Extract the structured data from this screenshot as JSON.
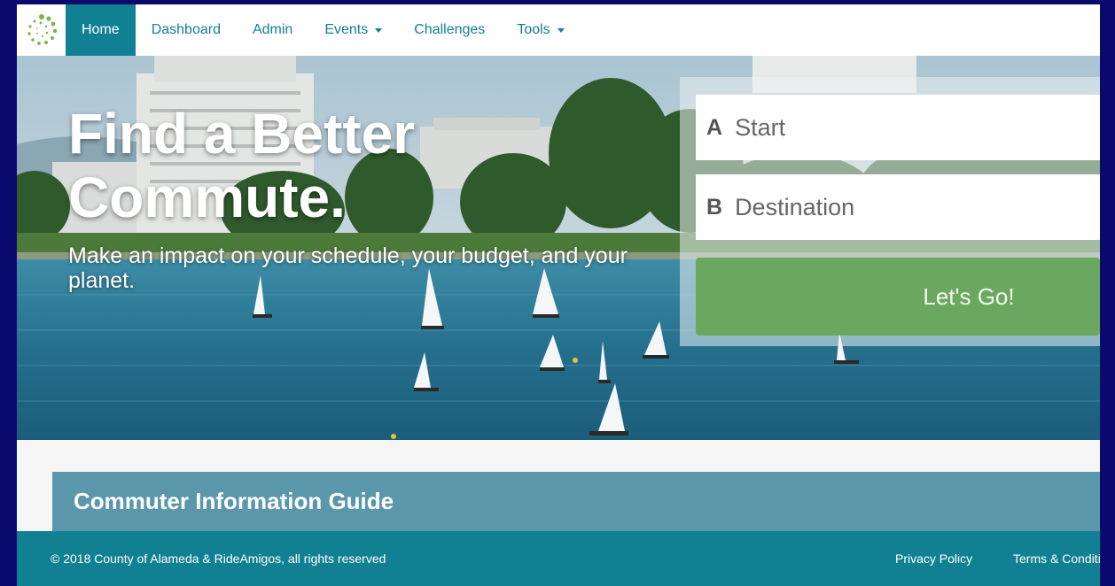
{
  "nav": {
    "items": [
      {
        "label": "Home",
        "active": true
      },
      {
        "label": "Dashboard"
      },
      {
        "label": "Admin"
      },
      {
        "label": "Events",
        "dropdown": true
      },
      {
        "label": "Challenges"
      },
      {
        "label": "Tools",
        "dropdown": true
      }
    ]
  },
  "hero": {
    "title": "Find a Better Commute.",
    "subtitle": "Make an impact on your schedule, your budget, and your planet."
  },
  "trip": {
    "start_letter": "A",
    "start_placeholder": "Start",
    "dest_letter": "B",
    "dest_placeholder": "Destination",
    "go_label": "Let's Go!"
  },
  "guide": {
    "title": "Commuter Information Guide"
  },
  "footer": {
    "copyright": "© 2018 County of Alameda & RideAmigos, all rights reserved",
    "privacy": "Privacy Policy",
    "terms": "Terms & Conditi"
  },
  "colors": {
    "brand": "#128093",
    "go_button": "#6aa860",
    "guide_bar": "#5a97ab",
    "page_border": "#0a0a6e"
  }
}
